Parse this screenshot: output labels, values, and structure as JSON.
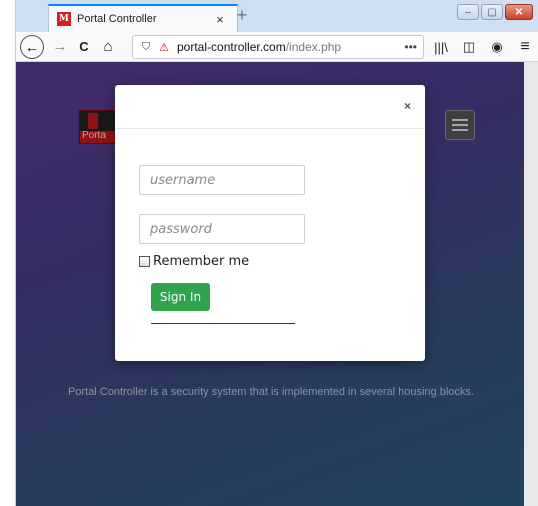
{
  "browser": {
    "tab_title": "Portal Controller",
    "tab_favicon_letter": "M",
    "tab_close": "×",
    "new_tab": "+",
    "url_domain": "portal-controller.com",
    "url_path": "/index.php",
    "url_more": "•••",
    "icons": {
      "back": "←",
      "forward": "→",
      "reload": "C",
      "home": "⌂",
      "shield": "⛉",
      "lock_warning": "⚠",
      "library": "|||\\",
      "sidebar": "◫",
      "account": "◉",
      "menu": "≡",
      "minimize": "–",
      "maximize": "▢",
      "close": "✕"
    }
  },
  "site": {
    "logo_word": "Porta",
    "description": "Portal Controller is a security system that is implemented in several housing blocks."
  },
  "modal": {
    "close_label": "×",
    "username_placeholder": "username",
    "password_placeholder": "password",
    "remember_label": "Remember me",
    "signin_label": "Sign In"
  }
}
